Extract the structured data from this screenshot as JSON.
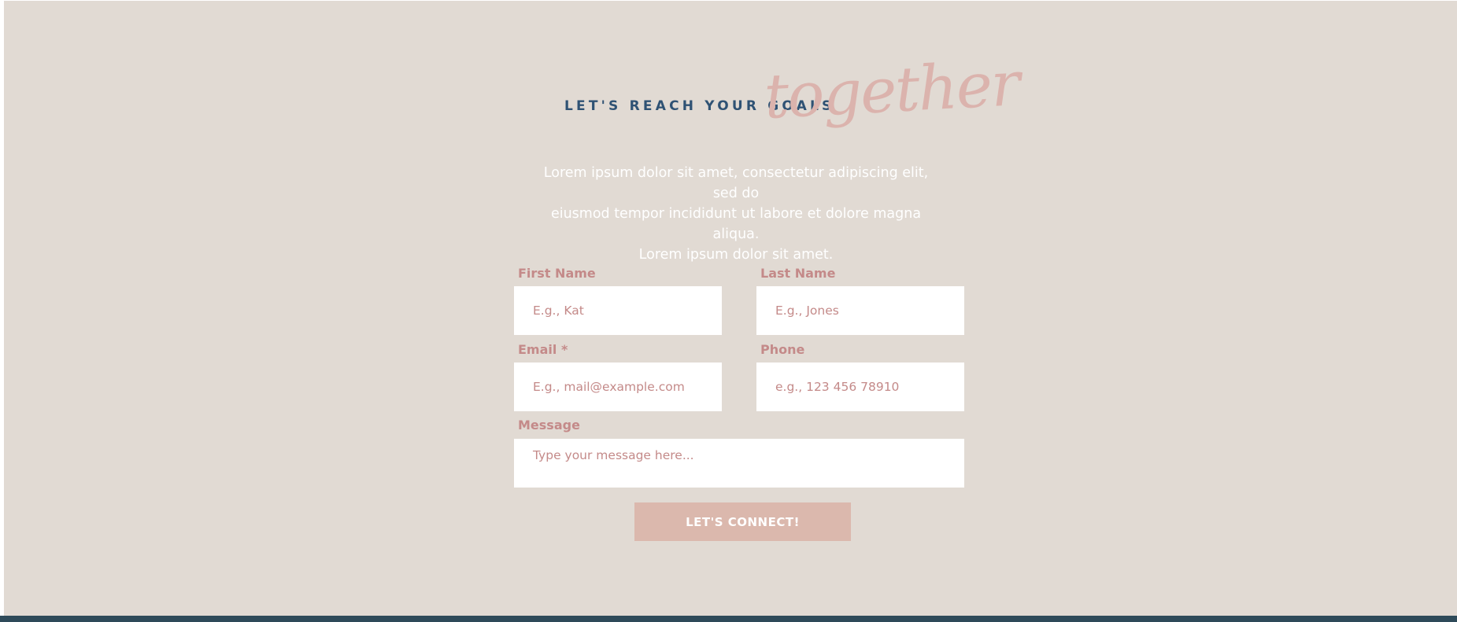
{
  "header": {
    "tagline": "LET'S REACH YOUR GOALS",
    "script_word": "together"
  },
  "intro": {
    "line1": "Lorem ipsum dolor sit amet, consectetur adipiscing elit, sed do",
    "line2": "eiusmod tempor incididunt ut labore et dolore magna aliqua.",
    "line3": "Lorem ipsum dolor sit amet."
  },
  "form": {
    "first_name": {
      "label": "First Name",
      "placeholder": "E.g., Kat",
      "value": ""
    },
    "last_name": {
      "label": "Last Name",
      "placeholder": "E.g., Jones",
      "value": ""
    },
    "email": {
      "label": "Email *",
      "placeholder": "E.g., mail@example.com",
      "value": ""
    },
    "phone": {
      "label": "Phone",
      "placeholder": "e.g., 123 456 78910",
      "value": ""
    },
    "message": {
      "label": "Message",
      "placeholder": "Type your message here...",
      "value": ""
    },
    "submit_label": "LET'S CONNECT!"
  },
  "colors": {
    "background": "#e1dad3",
    "navy": "#2f5274",
    "blush": "#dbb3ad",
    "label_rose": "#c48a89",
    "button": "#dbb8ad",
    "footer": "#2e4a59"
  }
}
